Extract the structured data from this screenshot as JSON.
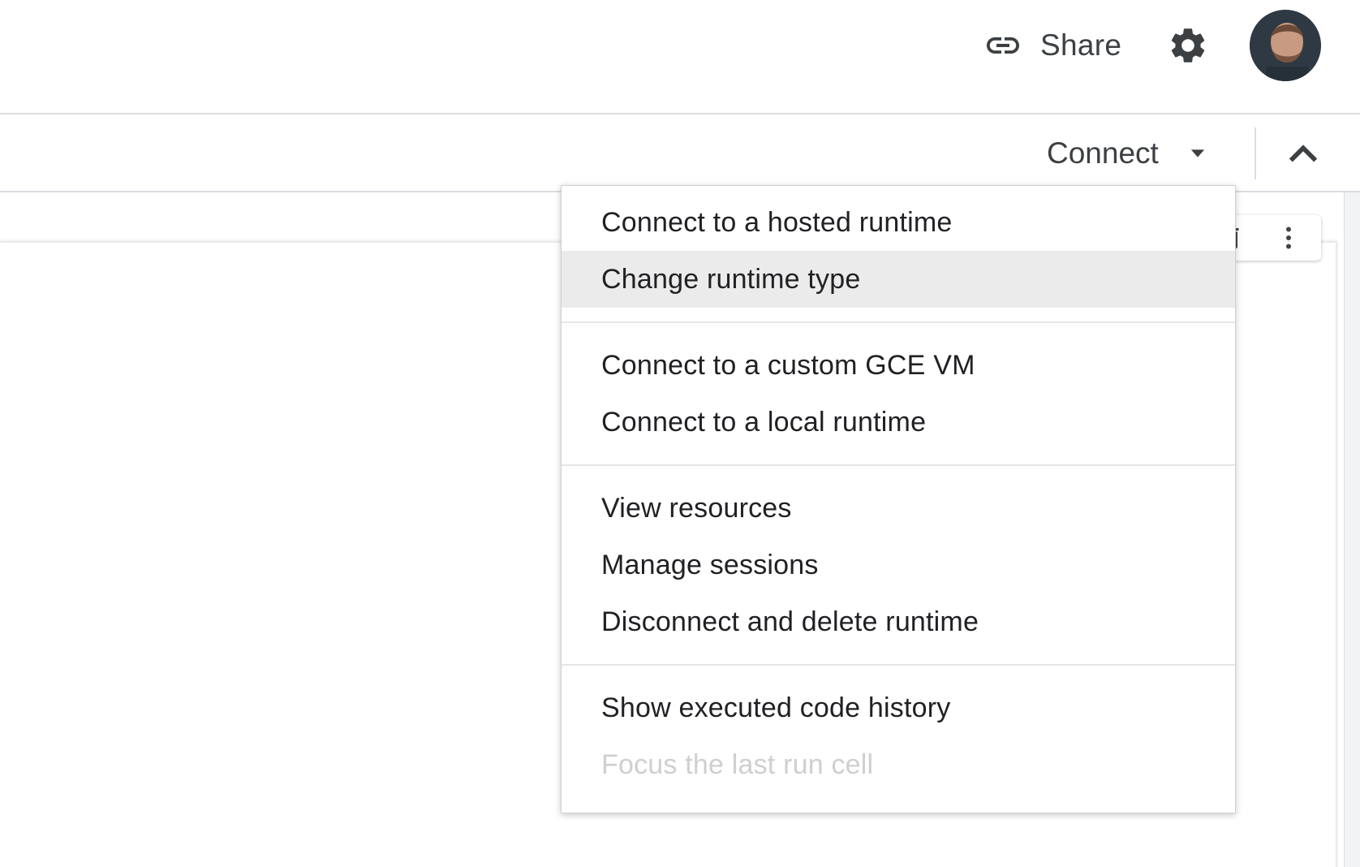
{
  "header": {
    "share_label": "Share",
    "icons": {
      "share": "link-icon",
      "settings": "gear-icon",
      "profile": "avatar"
    }
  },
  "toolbar": {
    "connect_label": "Connect",
    "icons": {
      "connect_dropdown": "caret-down-icon",
      "collapse": "chevron-up-icon"
    }
  },
  "cell_toolbar": {
    "icons": [
      "trash-icon",
      "more-vert-icon"
    ]
  },
  "menu": {
    "groups": [
      {
        "items": [
          {
            "label": "Connect to a hosted runtime",
            "state": "normal"
          },
          {
            "label": "Change runtime type",
            "state": "highlighted"
          }
        ]
      },
      {
        "items": [
          {
            "label": "Connect to a custom GCE VM",
            "state": "normal"
          },
          {
            "label": "Connect to a local runtime",
            "state": "normal"
          }
        ]
      },
      {
        "items": [
          {
            "label": "View resources",
            "state": "normal"
          },
          {
            "label": "Manage sessions",
            "state": "normal"
          },
          {
            "label": "Disconnect and delete runtime",
            "state": "normal"
          }
        ]
      },
      {
        "items": [
          {
            "label": "Show executed code history",
            "state": "normal"
          },
          {
            "label": "Focus the last run cell",
            "state": "disabled"
          }
        ]
      }
    ]
  },
  "colors": {
    "text": "#202124",
    "muted_text": "#3c4043",
    "disabled_text": "#cfcfcf",
    "highlight_bg": "#ebebeb",
    "divider": "#dadce0"
  }
}
